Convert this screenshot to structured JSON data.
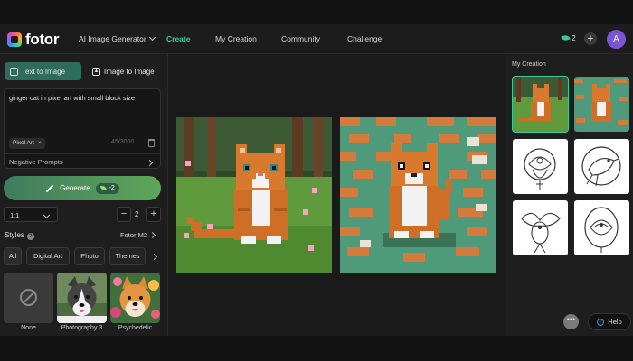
{
  "app": {
    "logo_text": "fotor",
    "nav": [
      {
        "label": "AI Image Generator",
        "dropdown": true
      },
      {
        "label": "Create",
        "active": true
      },
      {
        "label": "My Creation"
      },
      {
        "label": "Community"
      },
      {
        "label": "Challenge"
      }
    ],
    "credits": "2",
    "avatar_letter": "A",
    "accent_color": "#3cc99a"
  },
  "left_panel": {
    "tabs": [
      {
        "label": "Text to Image",
        "active": true
      },
      {
        "label": "Image to Image",
        "active": false
      }
    ],
    "prompt": {
      "value": "ginger cat in pixel art with small block size",
      "chip": "Pixel Art",
      "counter": "45/3000",
      "negative_prompts_label": "Negative Prompts"
    },
    "generate": {
      "label": "Generate",
      "cost": "-2"
    },
    "ratio": "1:1",
    "count": "2",
    "styles_label": "Styles",
    "model_label": "Fotor M2",
    "filters": [
      "All",
      "Digital Art",
      "Photo",
      "Themes"
    ],
    "style_cards": [
      {
        "name": "None",
        "icon": "none-icon"
      },
      {
        "name": "Photography 3"
      },
      {
        "name": "Psychedelic"
      }
    ]
  },
  "right_panel": {
    "title": "My Creation",
    "help_label": "Help"
  }
}
